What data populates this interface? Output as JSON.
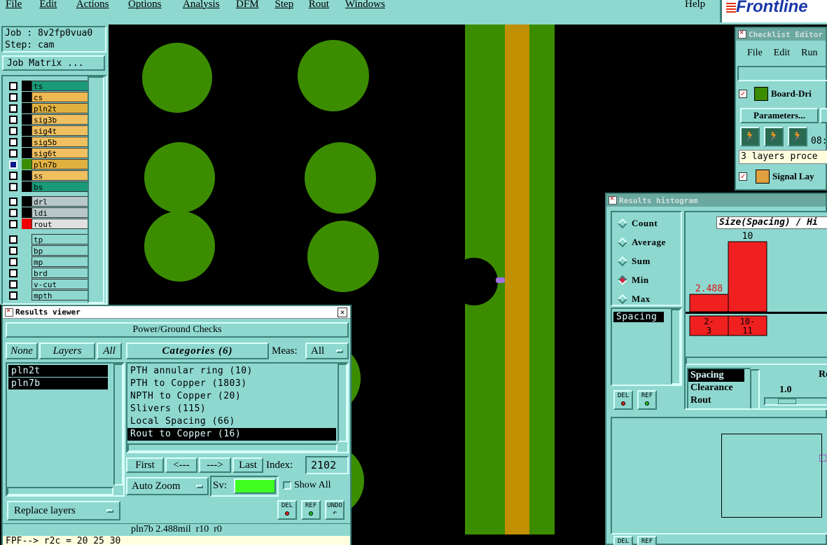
{
  "menu": [
    "File",
    "Edit",
    "Actions",
    "Options",
    "Analysis",
    "DFM",
    "Step",
    "Rout",
    "Windows"
  ],
  "menu_help": "Help",
  "brand": "Frontline",
  "job": {
    "job_line": "Job : 8v2fp0vua0",
    "step_line": "Step: cam",
    "matrix_button": "Job Matrix ..."
  },
  "layers_group1": [
    {
      "name": "ts",
      "color": "#1a9a78",
      "swatch": "#000"
    },
    {
      "name": "cs",
      "color": "#f0b850",
      "swatch": "#000"
    },
    {
      "name": "pln2t",
      "color": "#e0b040",
      "swatch": "#000"
    },
    {
      "name": "sig3b",
      "color": "#f0c060",
      "swatch": "#000"
    },
    {
      "name": "sig4t",
      "color": "#f0c060",
      "swatch": "#000"
    },
    {
      "name": "sig5b",
      "color": "#f0c060",
      "swatch": "#000"
    },
    {
      "name": "sig6t",
      "color": "#f0c060",
      "swatch": "#000"
    },
    {
      "name": "pln7b",
      "color": "#e0b040",
      "swatch": "#3c8c00",
      "active": true
    },
    {
      "name": "ss",
      "color": "#f0c060",
      "swatch": "#000"
    },
    {
      "name": "bs",
      "color": "#1a9a78",
      "swatch": "#000"
    }
  ],
  "layers_group2": [
    {
      "name": "drl",
      "color": "#b8c8c8",
      "swatch": "#000"
    },
    {
      "name": "ldi",
      "color": "#b8c8c8",
      "swatch": "#000"
    },
    {
      "name": "rout",
      "color": "#e0e0e0",
      "swatch": "#f00000"
    }
  ],
  "layers_group3": [
    {
      "name": "tp",
      "color": "#8ed8d0"
    },
    {
      "name": "bp",
      "color": "#8ed8d0"
    },
    {
      "name": "mp",
      "color": "#8ed8d0"
    },
    {
      "name": "brd",
      "color": "#8ed8d0"
    },
    {
      "name": "v-cut",
      "color": "#8ed8d0"
    },
    {
      "name": "mpth",
      "color": "#8ed8d0"
    }
  ],
  "results_viewer": {
    "title": "Results viewer",
    "section": "Power/Ground Checks",
    "none_btn": "None",
    "layers_label": "Layers",
    "all_btn": "All",
    "layer_list": [
      "pln2t",
      "pln7b"
    ],
    "categories_label": "Categories (6)",
    "meas_label": "Meas:",
    "meas_value": "All",
    "categories": [
      "PTH annular ring (10)",
      "PTH to Copper (1803)",
      "NPTH to Copper (20)",
      "Slivers (115)",
      "Local Spacing (66)",
      "Rout to Copper (16)"
    ],
    "selected_category": 5,
    "first": "First",
    "prev": "<---",
    "next": "--->",
    "last": "Last",
    "index_label": "Index:",
    "index_value": "2102",
    "auto_zoom": "Auto Zoom",
    "sv_label": "Sv:",
    "show_all": "Show All",
    "replace_layers": "Replace layers",
    "del": "DEL",
    "ref": "REF",
    "undo": "UNDO",
    "status": "pln7b 2.488mil  r10  r0",
    "console": "FPF--> r2c = 20 25 30"
  },
  "checklist": {
    "title": "Checklist Editor",
    "menu": [
      "File",
      "Edit",
      "Run"
    ],
    "item1": "Board-Dri",
    "params_btn": "Parameters...",
    "time": "08:",
    "processed": "3 layers proce",
    "item2": "Signal Lay"
  },
  "histogram": {
    "title": "Results histogram",
    "modes": [
      "Count",
      "Average",
      "Sum",
      "Min",
      "Max"
    ],
    "selected_mode": 3,
    "left_list": [
      "Spacing"
    ],
    "chart_title": "Size(Spacing) / Hi",
    "chart_data": {
      "type": "bar",
      "categories": [
        "2-\n3",
        "10-\n11"
      ],
      "values": [
        2.488,
        10
      ],
      "data_labels": [
        "2.488",
        "10"
      ],
      "color": "#f02020"
    },
    "meas_list": [
      "Spacing",
      "Clearance",
      "Rout"
    ],
    "re_label": "Re",
    "scale_value": "1.0",
    "del": "DEL",
    "ref": "REF"
  }
}
